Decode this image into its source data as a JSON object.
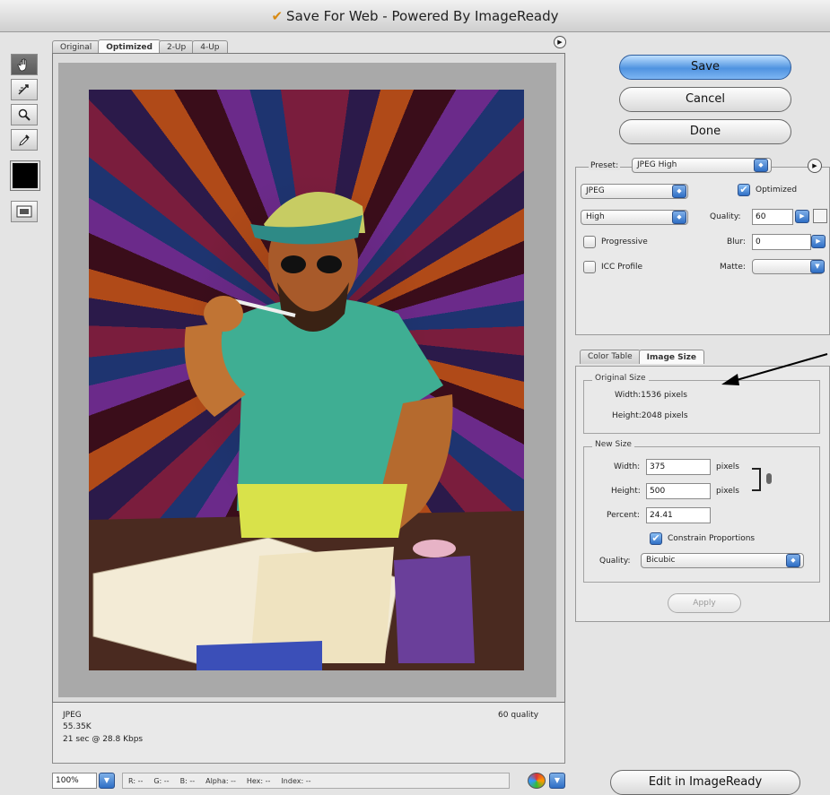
{
  "window": {
    "title": "Save For Web - Powered By ImageReady"
  },
  "tabs": [
    {
      "label": "Original"
    },
    {
      "label": "Optimized",
      "active": true
    },
    {
      "label": "2-Up"
    },
    {
      "label": "4-Up"
    }
  ],
  "tools": [
    "hand-icon",
    "slice-select-icon",
    "zoom-icon",
    "eyedropper-icon"
  ],
  "eyedropper_color": "#000000",
  "info": {
    "format": "JPEG",
    "size": "55.35K",
    "download_time": "21 sec @ 28.8 Kbps",
    "quality": "60 quality"
  },
  "status_bar": {
    "zoom": "100%",
    "readout": [
      {
        "label": "R:",
        "value": "--"
      },
      {
        "label": "G:",
        "value": "--"
      },
      {
        "label": "B:",
        "value": "--"
      },
      {
        "label": "Alpha:",
        "value": "--"
      },
      {
        "label": "Hex:",
        "value": "--"
      },
      {
        "label": "Index:",
        "value": "--"
      }
    ]
  },
  "buttons": {
    "save": "Save",
    "cancel": "Cancel",
    "done": "Done",
    "edit_in_imageready": "Edit in ImageReady",
    "apply": "Apply"
  },
  "settings": {
    "preset_label": "Preset:",
    "preset_value": "JPEG High",
    "format_value": "JPEG",
    "quality_level_value": "High",
    "optimized_label": "Optimized",
    "optimized_checked": true,
    "quality_label": "Quality:",
    "quality_value": "60",
    "progressive_label": "Progressive",
    "progressive_checked": false,
    "blur_label": "Blur:",
    "blur_value": "0",
    "icc_label": "ICC Profile",
    "icc_checked": false,
    "matte_label": "Matte:",
    "matte_value": ""
  },
  "size_tabs": [
    {
      "label": "Color Table"
    },
    {
      "label": "Image Size",
      "active": true
    }
  ],
  "image_size": {
    "original_title": "Original Size",
    "original_width": "Width:1536 pixels",
    "original_height": "Height:2048 pixels",
    "new_title": "New Size",
    "width_label": "Width:",
    "width_value": "375",
    "height_label": "Height:",
    "height_value": "500",
    "unit_pixels": "pixels",
    "percent_label": "Percent:",
    "percent_value": "24.41",
    "constrain_label": "Constrain Proportions",
    "constrain_checked": true,
    "quality_label": "Quality:",
    "quality_value": "Bicubic"
  }
}
